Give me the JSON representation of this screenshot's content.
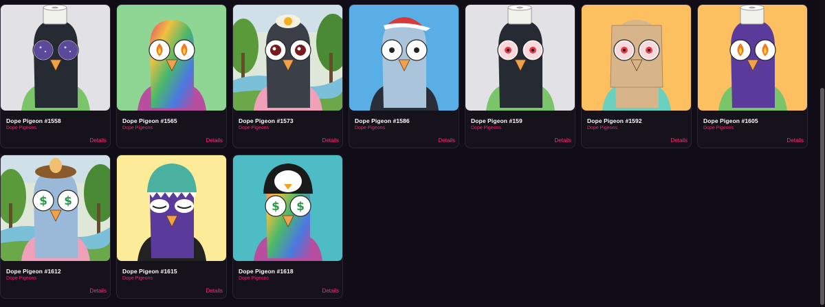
{
  "cards": [
    {
      "title": "Dope Pigeon #1558",
      "collection": "Dope Pigeons",
      "details": "Details",
      "art": {
        "bg": "#e2e2e6",
        "head": "#262b33",
        "hat": "toilet-roll",
        "hatColor": "#f2f2ec",
        "eyes": "glitter",
        "eyeColor": "#5b4a9a",
        "shirt": "#7ac46a",
        "beak": "#f0a24a"
      }
    },
    {
      "title": "Dope Pigeon #1565",
      "collection": "Dope Pigeons",
      "details": "Details",
      "art": {
        "bg": "#8fd694",
        "head": "rainbow",
        "hat": "none",
        "hatColor": "",
        "eyes": "fire",
        "eyeColor": "#f07a1e",
        "shirt": "#b84ea0",
        "beak": "#f0a24a"
      }
    },
    {
      "title": "Dope Pigeon #1573",
      "collection": "Dope Pigeons",
      "details": "Details",
      "art": {
        "bg": "forest",
        "head": "#3a3f48",
        "hat": "egg",
        "hatColor": "#f5f0e0",
        "eyes": "red",
        "eyeColor": "#7a1a1a",
        "shirt": "#f0a0b8",
        "beak": "#f0a24a"
      }
    },
    {
      "title": "Dope Pigeon #1586",
      "collection": "Dope Pigeons",
      "details": "Details",
      "art": {
        "bg": "#5aaee6",
        "head": "#aac4dc",
        "hat": "cap",
        "hatColor": "#d83a3a",
        "eyes": "normal",
        "eyeColor": "#222222",
        "shirt": "#2a2e38",
        "beak": "#f0a24a"
      }
    },
    {
      "title": "Dope Pigeon #159",
      "collection": "Dope Pigeons",
      "details": "Details",
      "art": {
        "bg": "#e2e2e6",
        "head": "#262b33",
        "hat": "toilet-roll",
        "hatColor": "#f2f2ec",
        "eyes": "bloodshot",
        "eyeColor": "#e83a4a",
        "shirt": "#7ac46a",
        "beak": "#f0a24a"
      }
    },
    {
      "title": "Dope Pigeon #1592",
      "collection": "Dope Pigeons",
      "details": "Details",
      "art": {
        "bg": "#fcc060",
        "head": "#d8b48a",
        "hat": "bag",
        "hatColor": "#d8b48a",
        "eyes": "bloodshot",
        "eyeColor": "#e83a4a",
        "shirt": "#6ad0c0",
        "beak": "#d8b48a"
      }
    },
    {
      "title": "Dope Pigeon #1605",
      "collection": "Dope Pigeons",
      "details": "Details",
      "art": {
        "bg": "#fcc060",
        "head": "#5a3a9a",
        "hat": "toilet-roll",
        "hatColor": "#f2f2ec",
        "eyes": "fire",
        "eyeColor": "#f07a1e",
        "shirt": "#7ac46a",
        "beak": "#f0a24a"
      }
    },
    {
      "title": "Dope Pigeon #1612",
      "collection": "Dope Pigeons",
      "details": "Details",
      "art": {
        "bg": "forest",
        "head": "#9ab8d8",
        "hat": "nest",
        "hatColor": "#8a5a2a",
        "eyes": "dollar",
        "eyeColor": "#2a9a4a",
        "shirt": "#f0a0b8",
        "beak": "#f0a24a"
      }
    },
    {
      "title": "Dope Pigeon #1615",
      "collection": "Dope Pigeons",
      "details": "Details",
      "art": {
        "bg": "#fcec9a",
        "head": "#5a3a9a",
        "hat": "shark",
        "hatColor": "#4ab0a0",
        "eyes": "closed",
        "eyeColor": "#222222",
        "shirt": "#222222",
        "beak": "#f0a24a"
      }
    },
    {
      "title": "Dope Pigeon #1618",
      "collection": "Dope Pigeons",
      "details": "Details",
      "art": {
        "bg": "#4ebcc4",
        "head": "rainbow",
        "hat": "penguin",
        "hatColor": "#1a1a1a",
        "eyes": "dollar",
        "eyeColor": "#2a9a4a",
        "shirt": "#b84ea0",
        "beak": "#f0a24a"
      }
    }
  ]
}
